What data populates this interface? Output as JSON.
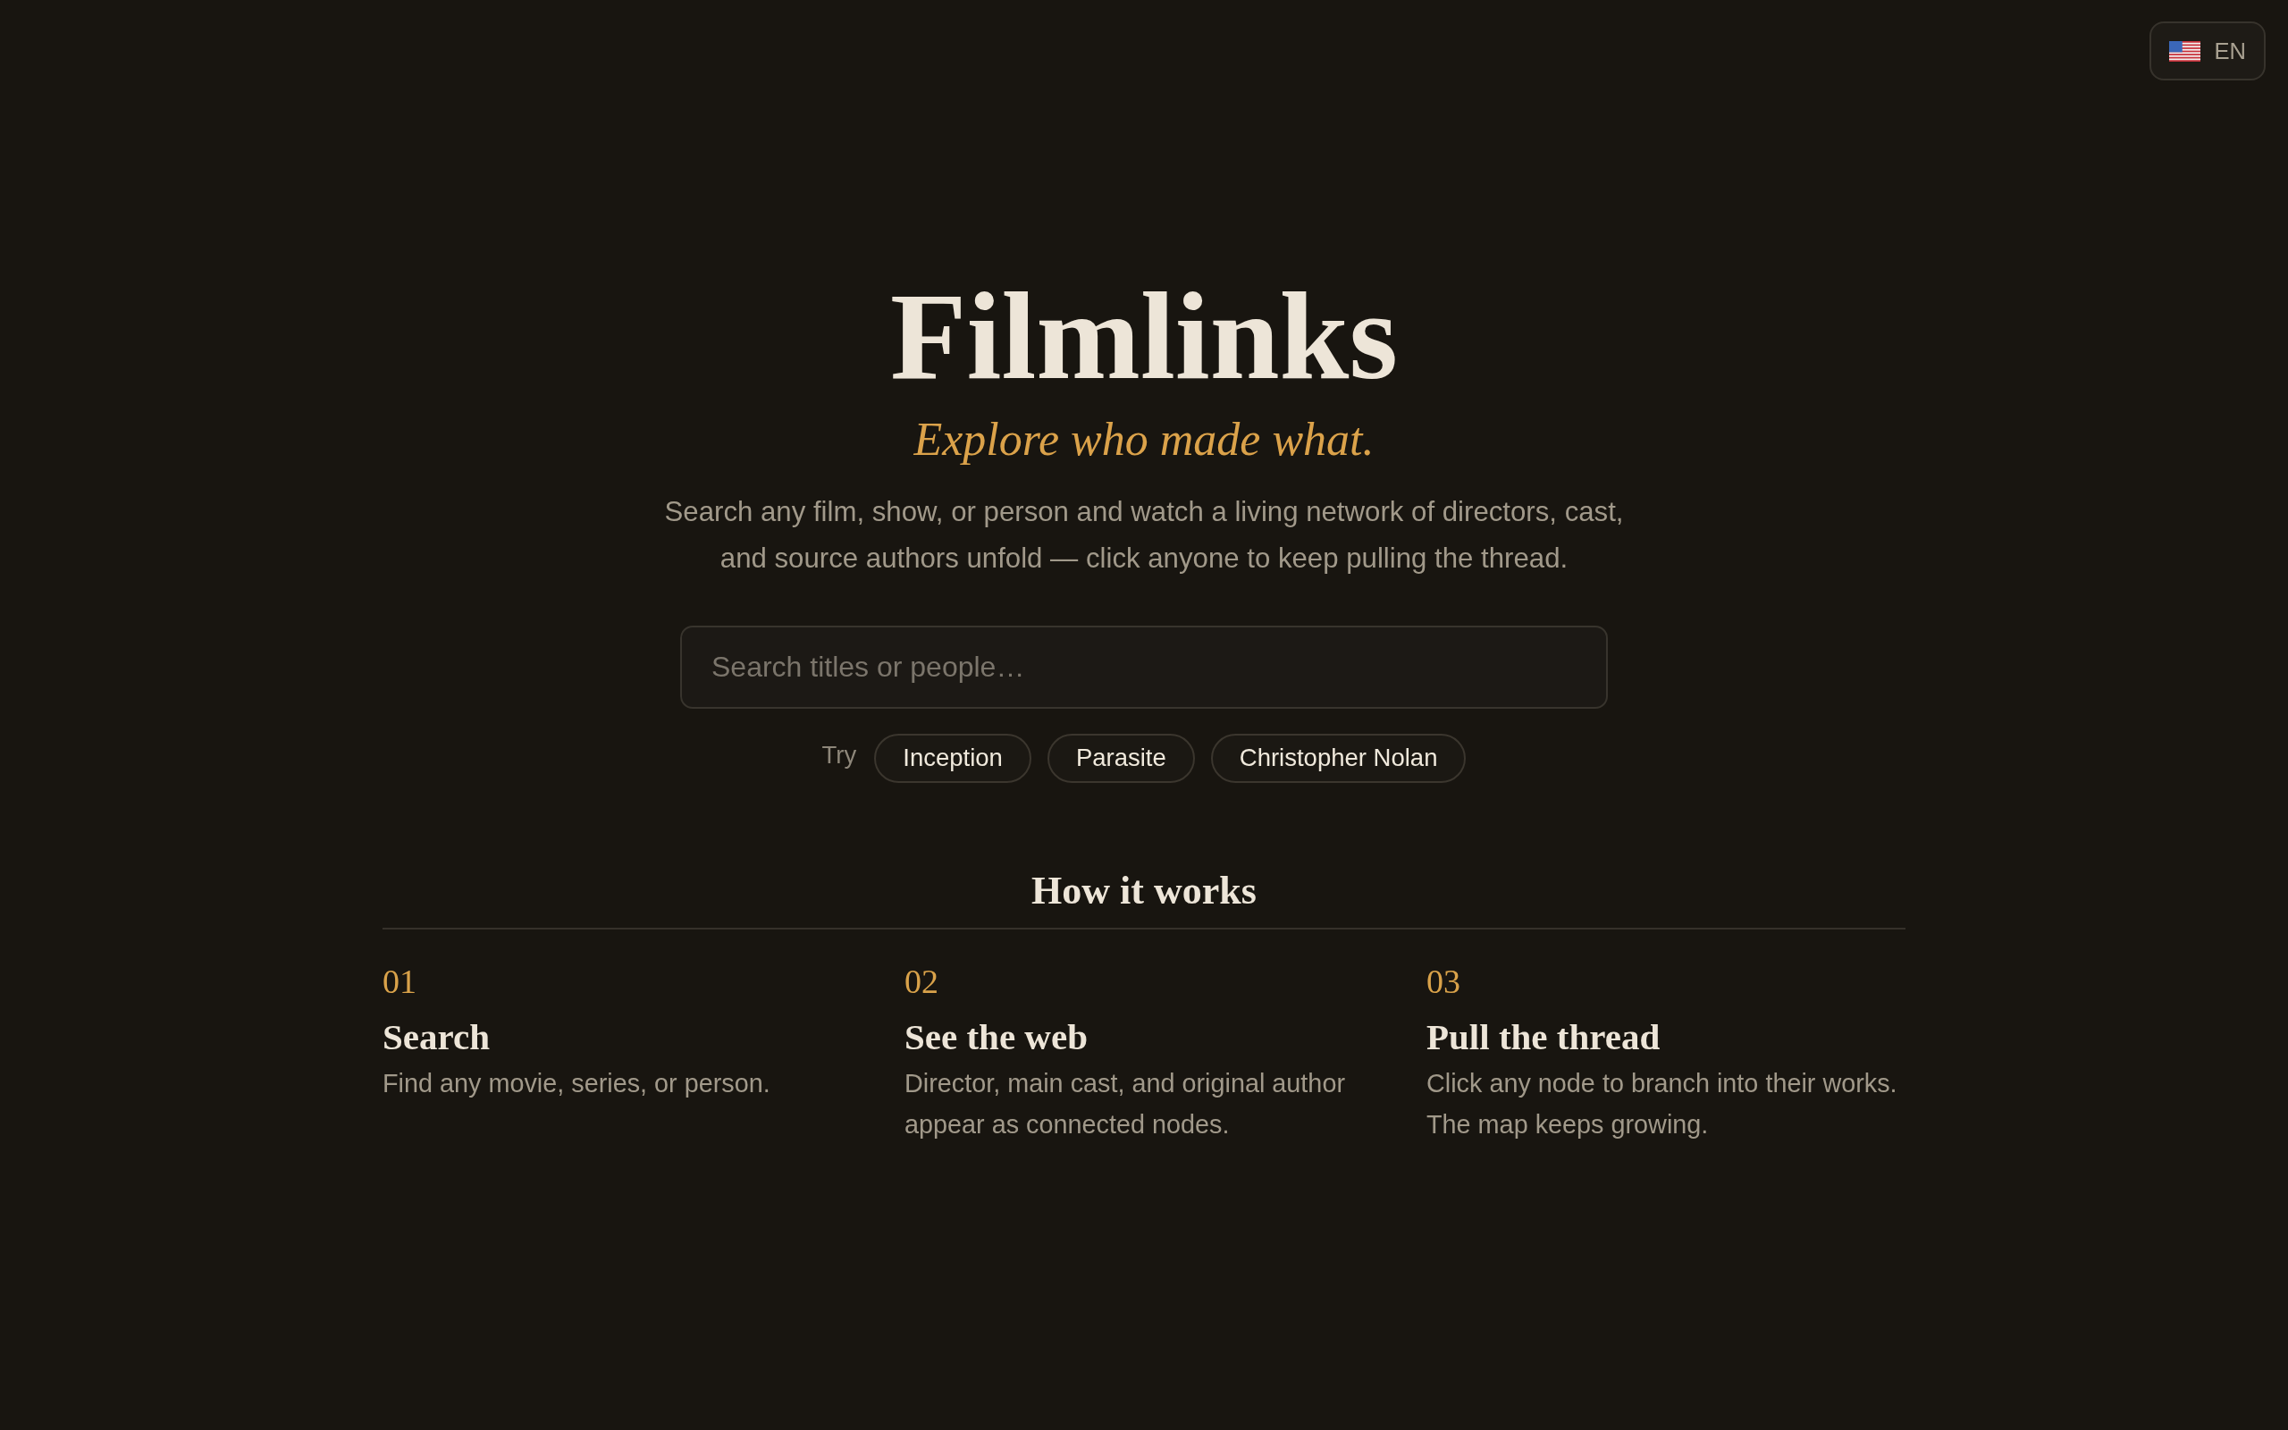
{
  "language_button": {
    "label": "EN"
  },
  "hero": {
    "title": "Filmlinks",
    "tagline": "Explore who made what.",
    "description": "Search any film, show, or person and watch a living network of directors, cast, and source authors unfold — click anyone to keep pulling the thread."
  },
  "search": {
    "placeholder": "Search titles or people…"
  },
  "suggestions": {
    "label": "Try",
    "items": [
      "Inception",
      "Parasite",
      "Christopher Nolan"
    ]
  },
  "how_it_works": {
    "heading": "How it works",
    "steps": [
      {
        "number": "01",
        "title": "Search",
        "text": "Find any movie, series, or person."
      },
      {
        "number": "02",
        "title": "See the web",
        "text": "Director, main cast, and original author appear as connected nodes."
      },
      {
        "number": "03",
        "title": "Pull the thread",
        "text": "Click any node to branch into their works. The map keeps growing."
      }
    ]
  }
}
